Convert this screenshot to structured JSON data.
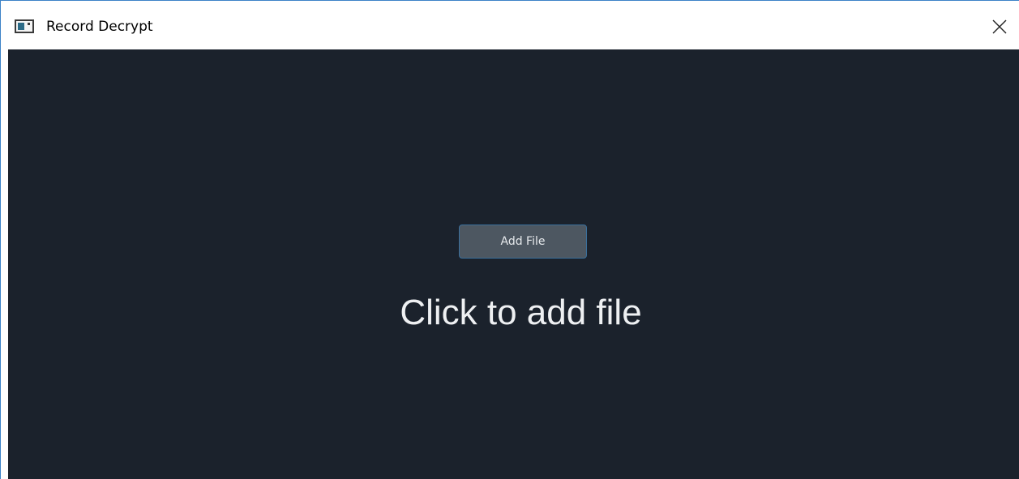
{
  "window": {
    "title": "Record Decrypt",
    "icon": "app-window-icon",
    "close_icon": "close-icon"
  },
  "main": {
    "add_button_label": "Add File",
    "hint_text": "Click to add file"
  },
  "colors": {
    "background": "#1b222c",
    "button_fill": "#4d5761",
    "button_border": "#3a6f9c",
    "text": "#eef0f2",
    "window_border": "#3c82c8"
  }
}
